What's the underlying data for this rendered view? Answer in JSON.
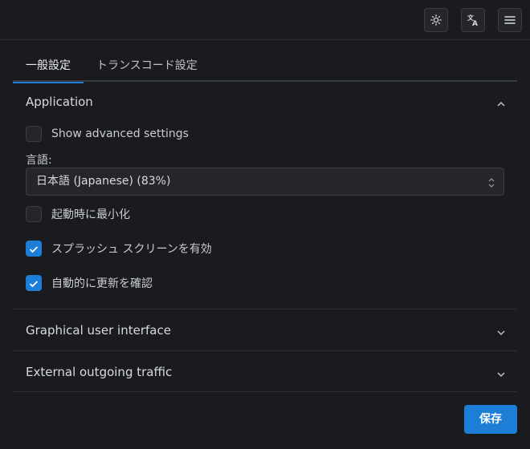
{
  "topbar": {
    "buttons": [
      {
        "icon": "sun-icon"
      },
      {
        "icon": "translate-icon"
      },
      {
        "icon": "hamburger-menu-icon"
      }
    ]
  },
  "tabs": [
    {
      "label": "一般設定",
      "active": true
    },
    {
      "label": "トランスコード設定",
      "active": false
    }
  ],
  "sections": {
    "application": {
      "title": "Application",
      "expanded": true,
      "show_advanced_label": "Show advanced settings",
      "show_advanced_checked": false,
      "language_label": "言語:",
      "language_value": "日本語 (Japanese) (83%)",
      "minimize_label": "起動時に最小化",
      "minimize_checked": false,
      "splash_label": "スプラッシュ スクリーンを有効",
      "splash_checked": true,
      "auto_update_label": "自動的に更新を確認",
      "auto_update_checked": true
    },
    "gui": {
      "title": "Graphical user interface",
      "expanded": false
    },
    "traffic": {
      "title": "External outgoing traffic",
      "expanded": false
    }
  },
  "save_label": "保存",
  "colors": {
    "accent": "#1c7ed6",
    "background": "#1a1b1f"
  }
}
